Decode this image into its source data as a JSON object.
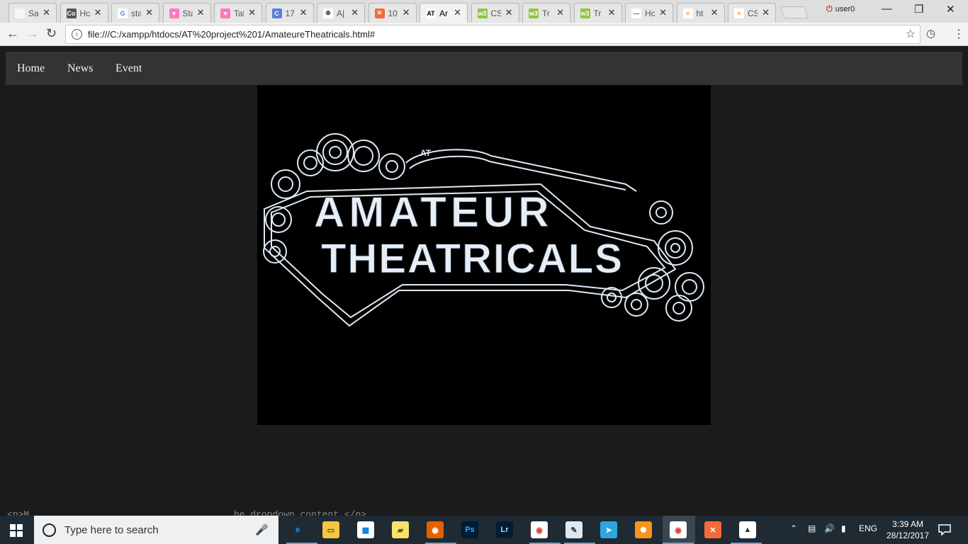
{
  "browser": {
    "tabs": [
      {
        "label": "Sa",
        "icon": "page-icon"
      },
      {
        "label": "Hc",
        "icon": "codeproject-icon"
      },
      {
        "label": "sta",
        "icon": "google-icon"
      },
      {
        "label": "Sta",
        "icon": "heart-icon"
      },
      {
        "label": "Tal",
        "icon": "heart-icon"
      },
      {
        "label": "17",
        "icon": "c-icon"
      },
      {
        "label": "A|",
        "icon": "globe-icon"
      },
      {
        "label": "10",
        "icon": "xampp-icon"
      },
      {
        "label": "Ar",
        "icon": "at-logo-icon"
      },
      {
        "label": "CS",
        "icon": "w3schools-icon"
      },
      {
        "label": "Tr",
        "icon": "w3schools-icon"
      },
      {
        "label": "Tr",
        "icon": "w3schools-icon"
      },
      {
        "label": "Hc",
        "icon": "red-dash-icon"
      },
      {
        "label": "ht",
        "icon": "stackoverflow-icon"
      },
      {
        "label": "CS",
        "icon": "stackoverflow-icon"
      }
    ],
    "active_tab_index": 8,
    "user": "user0",
    "address": "file:///C:/xampp/htdocs/AT%20project%201/AmateureTheatricals.html#"
  },
  "page": {
    "nav": [
      "Home",
      "News",
      "Event"
    ],
    "logo": {
      "line1": "AMATEUR",
      "line2": "THEATRICALS",
      "badge": "AT"
    },
    "stray_text": "<p>M                                     he dropdown content.</p>"
  },
  "taskbar": {
    "search_placeholder": "Type here to search",
    "apps": [
      "edge-icon",
      "file-explorer-icon",
      "store-icon",
      "sticky-notes-icon",
      "firefox-icon",
      "photoshop-icon",
      "lightroom-icon",
      "chrome-icon",
      "notepad-icon",
      "telegram-icon",
      "uc-browser-icon",
      "chrome-icon",
      "xampp-icon",
      "photos-icon"
    ],
    "language": "ENG",
    "time": "3:39 AM",
    "date": "28/12/2017"
  }
}
